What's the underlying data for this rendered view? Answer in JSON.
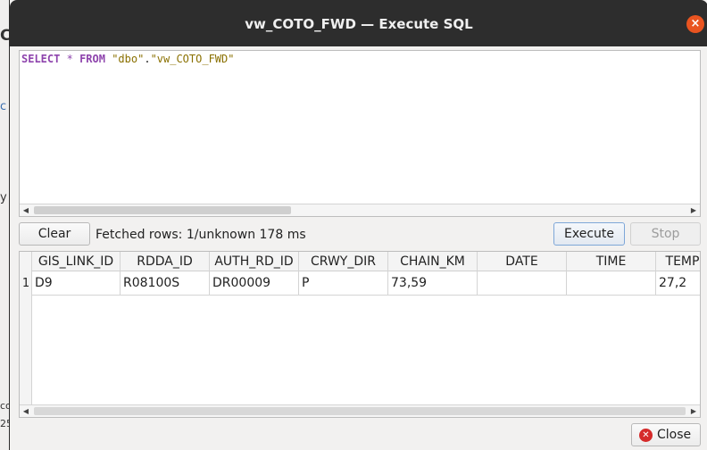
{
  "window": {
    "title": "vw_COTO_FWD — Execute SQL"
  },
  "background_window": {
    "chars": [
      "C",
      "c",
      "y",
      "co",
      "25"
    ]
  },
  "editor": {
    "sql_tokens": [
      {
        "text": "SELECT",
        "kind": "kw"
      },
      {
        "text": " ",
        "kind": "plain"
      },
      {
        "text": "*",
        "kind": "op"
      },
      {
        "text": " ",
        "kind": "plain"
      },
      {
        "text": "FROM",
        "kind": "kw"
      },
      {
        "text": " ",
        "kind": "plain"
      },
      {
        "text": "\"dbo\"",
        "kind": "str"
      },
      {
        "text": ".",
        "kind": "plain"
      },
      {
        "text": "\"vw_COTO_FWD\"",
        "kind": "str"
      }
    ]
  },
  "toolbar": {
    "clear_label": "Clear",
    "status_text": "Fetched rows: 1/unknown  178 ms",
    "execute_label": "Execute",
    "stop_label": "Stop"
  },
  "results": {
    "columns": [
      "GIS_LINK_ID",
      "RDDA_ID",
      "AUTH_RD_ID",
      "CRWY_DIR",
      "CHAIN_KM",
      "DATE",
      "TIME",
      "TEMP"
    ],
    "rows": [
      {
        "num": "1",
        "cells": [
          "D9",
          "R08100S",
          "DR00009",
          "P",
          "73,59",
          "",
          "",
          "27,2"
        ]
      }
    ]
  },
  "footer": {
    "close_label": "Close"
  },
  "colors": {
    "accent_close": "#e95420",
    "keyword": "#8e44ad",
    "string": "#8a7000"
  }
}
